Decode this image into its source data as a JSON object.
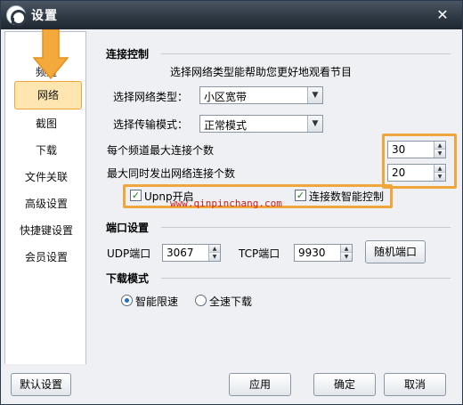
{
  "window": {
    "title": "设置",
    "close_glyph": "✕"
  },
  "sidebar": {
    "items": [
      {
        "label": "频道"
      },
      {
        "label": "网络"
      },
      {
        "label": "截图"
      },
      {
        "label": "下载"
      },
      {
        "label": "文件关联"
      },
      {
        "label": "高级设置"
      },
      {
        "label": "快捷键设置"
      },
      {
        "label": "会员设置"
      }
    ],
    "selected": "网络"
  },
  "connection": {
    "title": "连接控制",
    "hint": "选择网络类型能帮助您更好地观看节目",
    "network_type_label": "选择网络类型：",
    "network_type_value": "小区宽带",
    "transfer_mode_label": "选择传输模式：",
    "transfer_mode_value": "正常模式",
    "max_per_channel_label": "每个频道最大连接个数",
    "max_per_channel_value": "30",
    "max_concurrent_label": "最大同时发出网络连接个数",
    "max_concurrent_value": "20",
    "upnp_label": "Upnp开启",
    "upnp_checked": true,
    "smart_conn_label": "连接数智能控制",
    "smart_conn_checked": true
  },
  "ports": {
    "title": "端口设置",
    "udp_label": "UDP端口",
    "udp_value": "3067",
    "tcp_label": "TCP端口",
    "tcp_value": "9930",
    "random_button": "随机端口"
  },
  "download_mode": {
    "title": "下载模式",
    "options": [
      {
        "label": "智能限速",
        "selected": true
      },
      {
        "label": "全速下载",
        "selected": false
      }
    ]
  },
  "watermark": "www.qinpinchang.com",
  "buttons": {
    "defaults": "默认设置",
    "apply": "应用",
    "ok": "确定",
    "cancel": "取消"
  },
  "colors": {
    "highlight": "#f0a63a",
    "titlebar": "#2f3944",
    "watermark": "#cc1f1f"
  },
  "icons": {
    "app": "app-logo-icon",
    "close": "close-icon",
    "dropdown": "chevron-down-icon",
    "spin": "spin-arrows-icon",
    "pointer": "orange-arrow-icon"
  }
}
